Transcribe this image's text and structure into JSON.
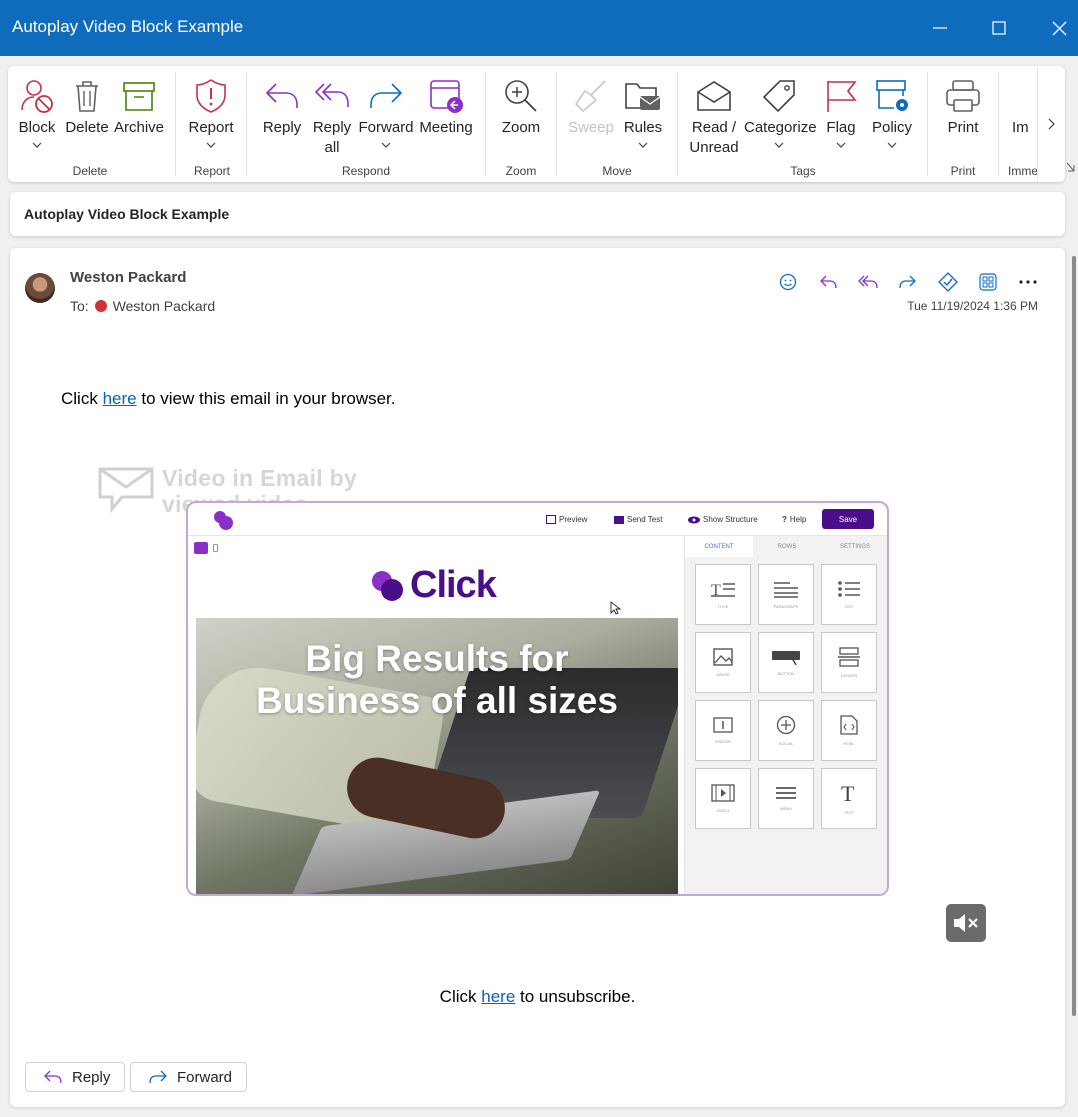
{
  "window": {
    "title": "Autoplay Video Block Example",
    "controls": [
      "minimize-icon",
      "maximize-icon",
      "close-icon"
    ]
  },
  "ribbon": {
    "buttons": {
      "block": "Block",
      "delete": "Delete",
      "archive": "Archive",
      "report": "Report",
      "reply": "Reply",
      "reply_all_1": "Reply",
      "reply_all_2": "all",
      "forward": "Forward",
      "meeting": "Meeting",
      "zoom": "Zoom",
      "sweep": "Sweep",
      "rules": "Rules",
      "read_unread_1": "Read /",
      "read_unread_2": "Unread",
      "categorize": "Categorize",
      "flag": "Flag",
      "policy": "Policy",
      "print": "Print",
      "immersive": "Im"
    },
    "groups": {
      "delete": "Delete",
      "report": "Report",
      "respond": "Respond",
      "zoom": "Zoom",
      "move": "Move",
      "tags": "Tags",
      "print": "Print",
      "immersive": "Imme"
    },
    "colors": {
      "block": "#c4314b",
      "archive": "#498205",
      "report": "#c4314b",
      "respond": "#8b2fc9",
      "forward": "#0f6cbd",
      "flag": "#c4314b",
      "policy": "#0f6cbd"
    }
  },
  "subject": "Autoplay Video Block Example",
  "message": {
    "sender": "Weston Packard",
    "to_label": "To:",
    "recipient": "Weston Packard",
    "date": "Tue 11/19/2024 1:36 PM",
    "browser_line": {
      "before": "Click",
      "link": "here",
      "after": "to view this email in your browser."
    },
    "unsubscribe_line": {
      "before": "Click",
      "link": "here",
      "after": "to unsubscribe."
    },
    "footer": {
      "reply": "Reply",
      "forward": "Forward"
    }
  },
  "video": {
    "watermark_line1": "Video in Email by",
    "watermark_line2": "viewed.video",
    "toolbar": {
      "preview": "Preview",
      "send_test": "Send Test",
      "show_structure": "Show Structure",
      "help": "Help",
      "save": "Save"
    },
    "logo_text": "Click",
    "headline_1": "Big Results for",
    "headline_2": "Business of all sizes",
    "tabs": [
      "CONTENT",
      "ROWS",
      "SETTINGS"
    ],
    "tiles": [
      "TITLE",
      "PARAGRAPH",
      "LIST",
      "IMAGE",
      "BUTTON",
      "DIVIDER",
      "SPACER",
      "SOCIAL",
      "HTML",
      "VIDEO",
      "MENU",
      "TEXT"
    ],
    "accent": "#4b0e8a"
  }
}
